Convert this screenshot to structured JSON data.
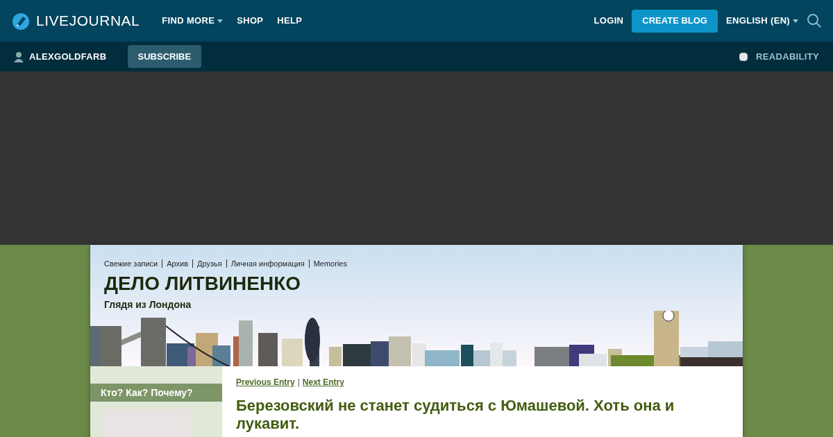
{
  "topbar": {
    "logo": "LIVEJOURNAL",
    "nav": [
      {
        "label": "FIND MORE",
        "dropdown": true
      },
      {
        "label": "SHOP",
        "dropdown": false
      },
      {
        "label": "HELP",
        "dropdown": false
      }
    ],
    "login": "LOGIN",
    "create": "CREATE BLOG",
    "language": "ENGLISH (EN)"
  },
  "subbar": {
    "user": "ALEXGOLDFARB",
    "subscribe": "SUBSCRIBE",
    "readability": {
      "label": "READABILITY",
      "checked": false
    }
  },
  "journal": {
    "links": [
      "Свежие записи",
      "Архив",
      "Друзья",
      "Личная информация",
      "Memories"
    ],
    "title": "ДЕЛО ЛИТВИНЕНКО",
    "subtitle": "Глядя из Лондона"
  },
  "sidebar": {
    "heading": "Кто? Как? Почему?"
  },
  "entry": {
    "prev": "Previous Entry",
    "separator": "|",
    "next": "Next Entry",
    "title": "Березовский не станет судиться с Юмашевой. Хоть она и лукавит."
  }
}
